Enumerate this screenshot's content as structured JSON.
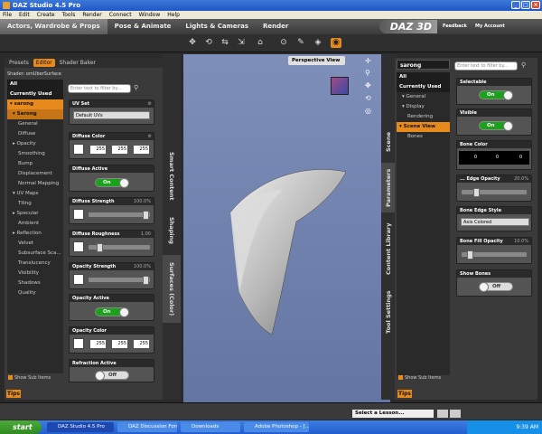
{
  "window": {
    "title": "DAZ Studio 4.5 Pro"
  },
  "menu": [
    "File",
    "Edit",
    "Create",
    "Tools",
    "Render",
    "Connect",
    "Window",
    "Help"
  ],
  "main_tabs": [
    "Actors, Wardrobe & Props",
    "Pose & Animate",
    "Lights & Cameras",
    "Render"
  ],
  "brand": {
    "logo": "DAZ 3D",
    "feedback": "Feedback",
    "my_account": "My Account"
  },
  "toolbar_icons": [
    "universal-tool-icon",
    "rotate-tool-icon",
    "translate-tool-icon",
    "scale-tool-icon",
    "node-select-icon",
    "camera-tool-icon",
    "joint-editor-icon",
    "surface-select-icon",
    "render-icon"
  ],
  "left_panel": {
    "tabs": [
      "Presets",
      "Editor",
      "Shader Baker"
    ],
    "active_tab": "Editor",
    "shader_label": "Shader: omUberSurface",
    "tree": [
      {
        "label": "All",
        "kind": "top"
      },
      {
        "label": "Currently Used",
        "kind": "top"
      },
      {
        "label": "▾ sarong",
        "kind": "sel"
      },
      {
        "label": "▾ Sarong",
        "kind": "sel2"
      },
      {
        "label": "General",
        "kind": "item"
      },
      {
        "label": "Diffuse",
        "kind": "item"
      },
      {
        "label": "▸ Opacity",
        "kind": "grp"
      },
      {
        "label": "Smoothing",
        "kind": "item"
      },
      {
        "label": "Bump",
        "kind": "item"
      },
      {
        "label": "Displacement",
        "kind": "item"
      },
      {
        "label": "Normal Mapping",
        "kind": "item"
      },
      {
        "label": "▾ UV Maps",
        "kind": "grp"
      },
      {
        "label": "Tiling",
        "kind": "item"
      },
      {
        "label": "▸ Specular",
        "kind": "grp"
      },
      {
        "label": "Ambient",
        "kind": "item"
      },
      {
        "label": "▸ Reflection",
        "kind": "grp"
      },
      {
        "label": "Velvet",
        "kind": "item"
      },
      {
        "label": "Subsurface Sca...",
        "kind": "item"
      },
      {
        "label": "Translucency",
        "kind": "item"
      },
      {
        "label": "Visibility",
        "kind": "item"
      },
      {
        "label": "Shadows",
        "kind": "item"
      },
      {
        "label": "Quality",
        "kind": "item"
      }
    ],
    "filter_placeholder": "Enter text to filter by...",
    "props": {
      "uv_set": {
        "label": "UV Set",
        "value": "Default UVs"
      },
      "diffuse_color": {
        "label": "Diffuse Color",
        "r": "255",
        "g": "255",
        "b": "255"
      },
      "diffuse_active": {
        "label": "Diffuse Active",
        "value": "On"
      },
      "diffuse_strength": {
        "label": "Diffuse Strength",
        "value": "100.0%",
        "level": 1.0
      },
      "diffuse_roughness": {
        "label": "Diffuse Roughness",
        "value": "1.00",
        "level": 0.15
      },
      "opacity_strength": {
        "label": "Opacity Strength",
        "value": "100.0%",
        "level": 1.0
      },
      "opacity_active": {
        "label": "Opacity Active",
        "value": "On"
      },
      "opacity_color": {
        "label": "Opacity Color",
        "r": "255",
        "g": "255",
        "b": "255"
      },
      "refraction_active": {
        "label": "Refraction Active",
        "value": "Off"
      }
    },
    "show_sub_items": "Show Sub Items",
    "tips": "Tips",
    "vertical_tabs": [
      "Smart Content",
      "Shaping",
      "Surfaces (Color)"
    ]
  },
  "viewport": {
    "camera": "Perspective View"
  },
  "right_panel": {
    "node": "sarong",
    "filter_placeholder": "Enter text to filter by...",
    "tree": [
      {
        "label": "All",
        "kind": "top"
      },
      {
        "label": "Currently Used",
        "kind": "top"
      },
      {
        "label": "▾ General",
        "kind": "grp"
      },
      {
        "label": "▾ Display",
        "kind": "grp"
      },
      {
        "label": "Rendering",
        "kind": "item"
      },
      {
        "label": "▾ Scene View",
        "kind": "sel"
      },
      {
        "label": "Bones",
        "kind": "item"
      }
    ],
    "props": {
      "selectable": {
        "label": "Selectable",
        "value": "On"
      },
      "visible": {
        "label": "Visible",
        "value": "On"
      },
      "bone_color": {
        "label": "Bone Color",
        "r": "0",
        "g": "0",
        "b": "0"
      },
      "edge_opacity": {
        "label": "... Edge Opacity",
        "value": "20.0%",
        "level": 0.2
      },
      "bone_edge_style": {
        "label": "Bone Edge Style",
        "value": "Axis Colored"
      },
      "bone_fill_opacity": {
        "label": "Bone Fill Opacity",
        "value": "10.0%",
        "level": 0.1
      },
      "show_bones": {
        "label": "Show Bones",
        "value": "Off"
      }
    },
    "vertical_tabs": [
      "Scene",
      "Parameters",
      "Content Library",
      "Tool Settings"
    ],
    "show_sub_items": "Show Sub Items",
    "tips": "Tips"
  },
  "lesson": {
    "label": "Select a Lesson..."
  },
  "taskbar": {
    "start": "start",
    "tasks": [
      "DAZ Studio 4.5 Pro",
      "DAZ Discussion Foru...",
      "Downloads",
      "Adobe Photoshop - [..."
    ],
    "time": "9:39 AM"
  }
}
